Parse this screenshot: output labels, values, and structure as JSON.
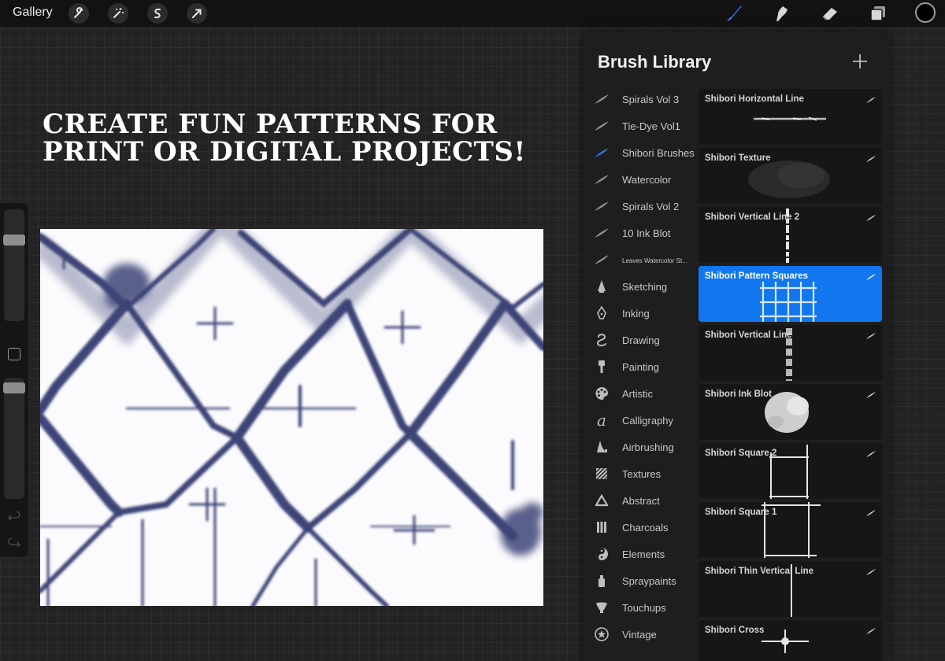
{
  "topbar": {
    "gallery_label": "Gallery",
    "left_tools": [
      "wrench-icon",
      "magic-wand-icon",
      "selection-icon",
      "transform-arrow-icon"
    ],
    "right_tools": [
      "brush-icon",
      "smudge-icon",
      "eraser-icon",
      "layers-icon"
    ],
    "active_tool_color": "#1f7cf0",
    "current_color": "#000000"
  },
  "headline": {
    "line1": "CREATE FUN PATTERNS FOR",
    "line2": "PRINT OR DIGITAL PROJECTS!"
  },
  "canvas": {
    "pattern_color": "#3c4577",
    "background_color": "#fbfbfd"
  },
  "brush_library": {
    "title": "Brush Library",
    "categories": [
      {
        "label": "Spirals Vol 3",
        "icon": "feather-stroke-icon"
      },
      {
        "label": "Tie-Dye Vol1",
        "icon": "feather-stroke-icon"
      },
      {
        "label": "Shibori Brushes",
        "icon": "feather-stroke-icon",
        "active": true
      },
      {
        "label": "Watercolor",
        "icon": "feather-stroke-icon"
      },
      {
        "label": "Spirals Vol 2",
        "icon": "feather-stroke-icon"
      },
      {
        "label": "10 Ink Blot",
        "icon": "feather-stroke-icon"
      },
      {
        "label": "Leaves Watercolor St...",
        "icon": "feather-stroke-icon"
      },
      {
        "label": "Sketching",
        "icon": "pencil-icon"
      },
      {
        "label": "Inking",
        "icon": "pen-nib-icon"
      },
      {
        "label": "Drawing",
        "icon": "squiggle-icon"
      },
      {
        "label": "Painting",
        "icon": "paintbrush-icon"
      },
      {
        "label": "Artistic",
        "icon": "palette-icon"
      },
      {
        "label": "Calligraphy",
        "icon": "calligraphy-icon"
      },
      {
        "label": "Airbrushing",
        "icon": "airbrush-icon"
      },
      {
        "label": "Textures",
        "icon": "texture-icon"
      },
      {
        "label": "Abstract",
        "icon": "triangle-icon"
      },
      {
        "label": "Charcoals",
        "icon": "charcoal-icon"
      },
      {
        "label": "Elements",
        "icon": "yin-yang-icon"
      },
      {
        "label": "Spraypaints",
        "icon": "spray-can-icon"
      },
      {
        "label": "Touchups",
        "icon": "touchup-icon"
      },
      {
        "label": "Vintage",
        "icon": "star-badge-icon"
      }
    ],
    "brushes": [
      {
        "name": "Shibori Horizontal Line"
      },
      {
        "name": "Shibori Texture"
      },
      {
        "name": "Shibori Vertical Line 2"
      },
      {
        "name": "Shibori Pattern Squares",
        "selected": true
      },
      {
        "name": "Shibori Vertical Line"
      },
      {
        "name": "Shibori Ink Blot"
      },
      {
        "name": "Shibori Square 2"
      },
      {
        "name": "Shibori Square 1"
      },
      {
        "name": "Shibori Thin Vertical Line"
      },
      {
        "name": "Shibori Cross"
      }
    ],
    "selected_color": "#1277ef"
  }
}
